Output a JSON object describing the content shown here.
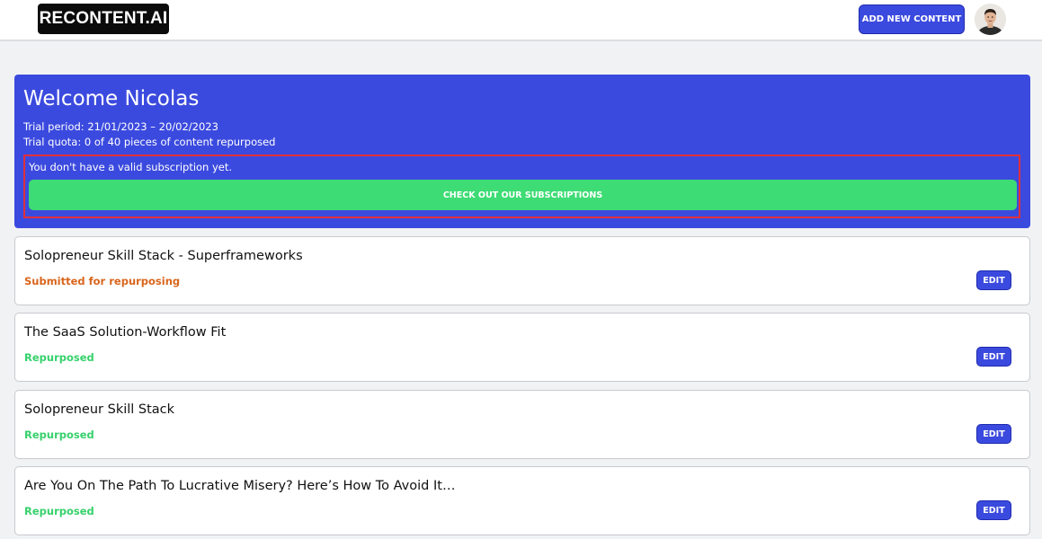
{
  "header": {
    "logo_text": "RECONTENT.AI",
    "add_button_label": "ADD NEW CONTENT",
    "avatar_icon": "user-avatar"
  },
  "welcome": {
    "title": "Welcome Nicolas",
    "trial_period": "Trial period: 21/01/2023 – 20/02/2023",
    "trial_quota": "Trial quota: 0 of 40 pieces of content repurposed",
    "subscription_notice": "You don't have a valid subscription yet.",
    "subscription_button_label": "CHECK OUT OUR SUBSCRIPTIONS"
  },
  "content_items": [
    {
      "title": "Solopreneur Skill Stack - Superframeworks",
      "status": "Submitted for repurposing",
      "status_color": "#d9651c",
      "edit_label": "EDIT"
    },
    {
      "title": "The SaaS Solution-Workflow Fit",
      "status": "Repurposed",
      "status_color": "#36d16b",
      "edit_label": "EDIT"
    },
    {
      "title": "Solopreneur Skill Stack",
      "status": "Repurposed",
      "status_color": "#36d16b",
      "edit_label": "EDIT"
    },
    {
      "title": "Are You On The Path To Lucrative Misery? Here’s How To Avoid It…",
      "status": "Repurposed",
      "status_color": "#36d16b",
      "edit_label": "EDIT"
    }
  ],
  "colors": {
    "accent": "#3b4ade",
    "success": "#3ddc74",
    "warning": "#d9651c",
    "alert_border": "#e0303b"
  }
}
